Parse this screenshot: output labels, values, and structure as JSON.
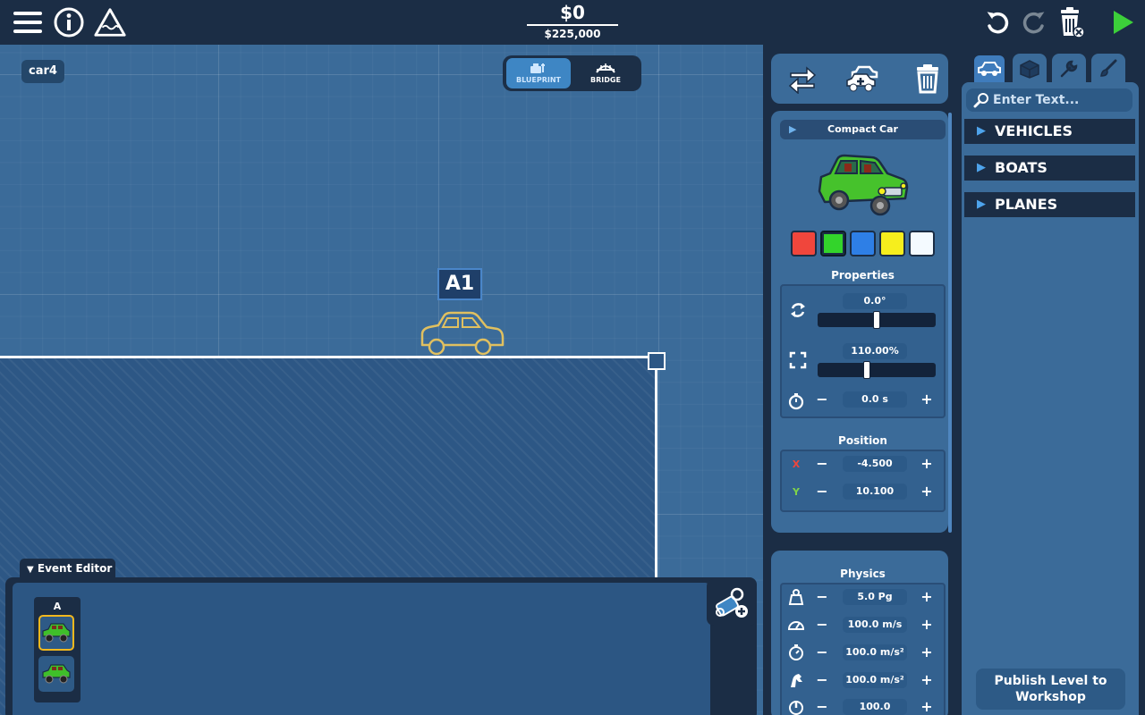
{
  "topbar": {
    "cost": "$0",
    "budget": "$225,000"
  },
  "canvas": {
    "level_name": "car4",
    "modes": [
      {
        "label": "BLUEPRINT",
        "active": true
      },
      {
        "label": "BRIDGE",
        "active": false
      }
    ],
    "car_tag": "A1"
  },
  "event_editor": {
    "tab_label": "Event Editor",
    "column_header": "A"
  },
  "vehicle": {
    "name": "Compact Car",
    "body_color": "#3fbf2a",
    "colors": [
      "#f0463c",
      "#33d42b",
      "#2e7fe6",
      "#f6ee1d",
      "#f4faff"
    ],
    "selected_color_index": 1
  },
  "properties": {
    "title": "Properties",
    "rotation": "0.0°",
    "rotation_level": 0.5,
    "scale": "110.00%",
    "scale_level": 0.41,
    "delay": "0.0 s"
  },
  "position": {
    "title": "Position",
    "x_label": "X",
    "x": "-4.500",
    "y_label": "Y",
    "y": "10.100"
  },
  "physics": {
    "title": "Physics",
    "mass": "5.0 Pg",
    "speed": "100.0 m/s",
    "acceleration": "100.0 m/s²",
    "acceleration2": "100.0 m/s²",
    "power": "100.0"
  },
  "library": {
    "search_placeholder": "Enter Text...",
    "categories": [
      "VEHICLES",
      "BOATS",
      "PLANES"
    ],
    "publish_label": "Publish Level to Workshop"
  },
  "colors": {
    "panel_dark": "#1b2d45",
    "panel_mid": "#3b6b99",
    "accent": "#3e86c4",
    "play_green": "#3ccf3a",
    "selection_gold": "#f2b81e",
    "outline_car": "#e0c060"
  }
}
